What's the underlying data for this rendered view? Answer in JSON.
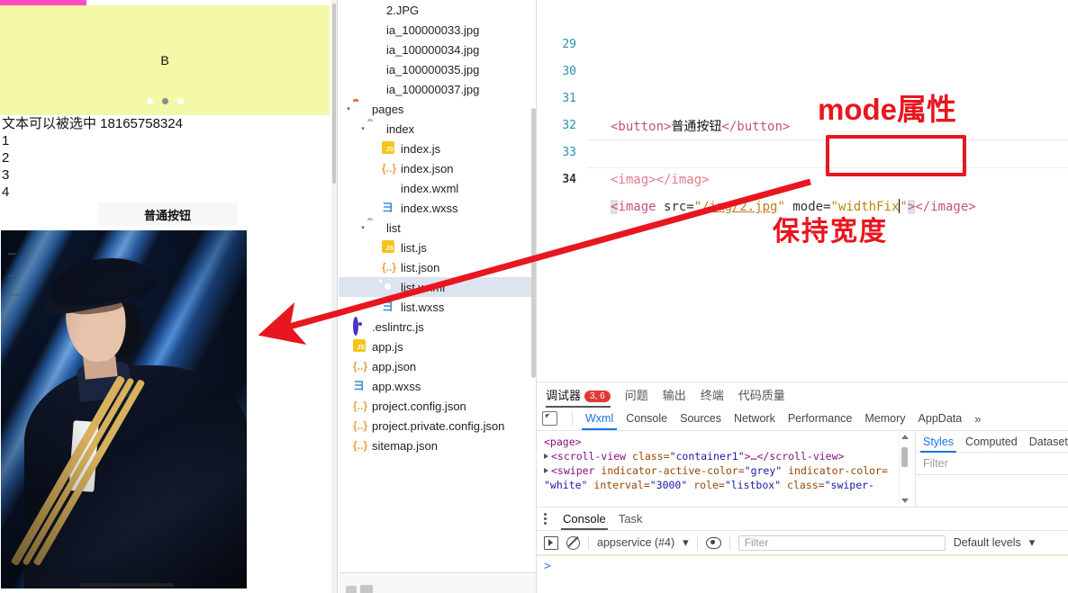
{
  "simulator": {
    "swiper": {
      "letter": "B",
      "dots": 3,
      "active_dot_index": 1,
      "bg_color": "#f4f9a8"
    },
    "topbar_color": "#ff4ec4",
    "text_lines": [
      "文本可以被选中 18165758324",
      "1",
      "2",
      "3",
      "4"
    ],
    "button_label": "普通按钮",
    "photo_alt": "concert photo of person in cap and striped jacket"
  },
  "file_tree": [
    {
      "label": "2.JPG",
      "icon": "image-file-icon",
      "indent": 2,
      "caret": ""
    },
    {
      "label": "ia_100000033.jpg",
      "icon": "image-file-icon",
      "indent": 2,
      "caret": ""
    },
    {
      "label": "ia_100000034.jpg",
      "icon": "image-file-icon",
      "indent": 2,
      "caret": ""
    },
    {
      "label": "ia_100000035.jpg",
      "icon": "image-file-icon",
      "indent": 2,
      "caret": ""
    },
    {
      "label": "ia_100000037.jpg",
      "icon": "image-file-icon",
      "indent": 2,
      "caret": ""
    },
    {
      "label": "pages",
      "icon": "folder-pages-icon",
      "indent": 1,
      "caret": "▾"
    },
    {
      "label": "index",
      "icon": "folder-icon",
      "indent": 2,
      "caret": "▾"
    },
    {
      "label": "index.js",
      "icon": "js-file-icon",
      "indent": 3,
      "caret": ""
    },
    {
      "label": "index.json",
      "icon": "json-file-icon",
      "indent": 3,
      "caret": ""
    },
    {
      "label": "index.wxml",
      "icon": "wxml-file-icon",
      "indent": 3,
      "caret": ""
    },
    {
      "label": "index.wxss",
      "icon": "wxss-file-icon",
      "indent": 3,
      "caret": ""
    },
    {
      "label": "list",
      "icon": "folder-icon",
      "indent": 2,
      "caret": "▾"
    },
    {
      "label": "list.js",
      "icon": "js-file-icon",
      "indent": 3,
      "caret": ""
    },
    {
      "label": "list.json",
      "icon": "json-file-icon",
      "indent": 3,
      "caret": ""
    },
    {
      "label": "list.wxml",
      "icon": "wxml-file-icon",
      "indent": 3,
      "caret": "",
      "selected": true
    },
    {
      "label": "list.wxss",
      "icon": "wxss-file-icon",
      "indent": 3,
      "caret": ""
    },
    {
      "label": ".eslintrc.js",
      "icon": "eslint-file-icon",
      "indent": 1,
      "caret": ""
    },
    {
      "label": "app.js",
      "icon": "js-file-icon",
      "indent": 1,
      "caret": ""
    },
    {
      "label": "app.json",
      "icon": "json-file-icon",
      "indent": 1,
      "caret": ""
    },
    {
      "label": "app.wxss",
      "icon": "wxss-file-icon",
      "indent": 1,
      "caret": ""
    },
    {
      "label": "project.config.json",
      "icon": "json-file-icon",
      "indent": 1,
      "caret": ""
    },
    {
      "label": "project.private.config.json",
      "icon": "json-file-icon",
      "indent": 1,
      "caret": ""
    },
    {
      "label": "sitemap.json",
      "icon": "json-file-icon",
      "indent": 1,
      "caret": ""
    }
  ],
  "editor": {
    "lines": [
      {
        "num": "29",
        "text": ""
      },
      {
        "num": "30",
        "text": ""
      },
      {
        "num": "31",
        "text": "<button>普通按钮</button>"
      },
      {
        "num": "32",
        "text": ""
      },
      {
        "num": "33",
        "text": "<imag></imag>"
      },
      {
        "num": "34",
        "text": "<image src=\"/img/2.jpg\" mode=\"widthFix\"></image>"
      }
    ],
    "line31": {
      "open_tag": "<button>",
      "cjk": "普通按钮",
      "close_tag": "</button>"
    },
    "line33": {
      "open_tag": "<imag>",
      "close_tag": "</imag>"
    },
    "line34": {
      "lt": "<",
      "tag": "image",
      "attr_src": " src=",
      "quote": "\"",
      "src_value": "/img/2.jpg",
      "attr_mode": "mode=",
      "mode_value": "widthFix",
      "gt": ">",
      "close_tag": "</image>"
    },
    "current_line": "34"
  },
  "annotations": {
    "mode_label": "mode属性",
    "keep_width_label": "保持宽度",
    "color": "#e8161f"
  },
  "devtools": {
    "top_tabs": [
      {
        "label": "调试器",
        "badge": "3, 6",
        "active": true
      },
      {
        "label": "问题",
        "badge": "",
        "active": false
      },
      {
        "label": "输出",
        "badge": "",
        "active": false
      },
      {
        "label": "终端",
        "badge": "",
        "active": false
      },
      {
        "label": "代码质量",
        "badge": "",
        "active": false
      }
    ],
    "panel_tabs": [
      {
        "label": "Wxml",
        "active": true
      },
      {
        "label": "Console",
        "active": false
      },
      {
        "label": "Sources",
        "active": false
      },
      {
        "label": "Network",
        "active": false
      },
      {
        "label": "Performance",
        "active": false
      },
      {
        "label": "Memory",
        "active": false
      },
      {
        "label": "AppData",
        "active": false
      }
    ],
    "panel_tabs_overflow": "»",
    "wxml": {
      "root": "<page>",
      "node1": {
        "tag_open": "<scroll-view ",
        "attr": "class=",
        "val": "\"container1\"",
        "tail": ">…</scroll-view>"
      },
      "node2_part1": {
        "tag_open": "<swiper ",
        "a1": "indicator-active-color=",
        "v1": "\"grey\"",
        "a2": " indicator-color="
      },
      "node2_part2": {
        "v2": "\"white\"",
        "a3": " interval=",
        "v3": "\"3000\"",
        "a4": " role=",
        "v4": "\"listbox\"",
        "a5": " class=",
        "v5": "\"swiper-"
      }
    },
    "styles_tabs": [
      {
        "label": "Styles",
        "active": true
      },
      {
        "label": "Computed",
        "active": false
      },
      {
        "label": "Dataset",
        "active": false
      }
    ],
    "styles_filter_placeholder": "Filter",
    "console_tabs": [
      {
        "label": "Console",
        "active": true
      },
      {
        "label": "Task",
        "active": false
      }
    ],
    "console_context": "appservice (#4)",
    "console_filter_placeholder": "Filter",
    "console_levels": "Default levels",
    "console_levels_caret": "▾",
    "console_prompt": ">"
  }
}
